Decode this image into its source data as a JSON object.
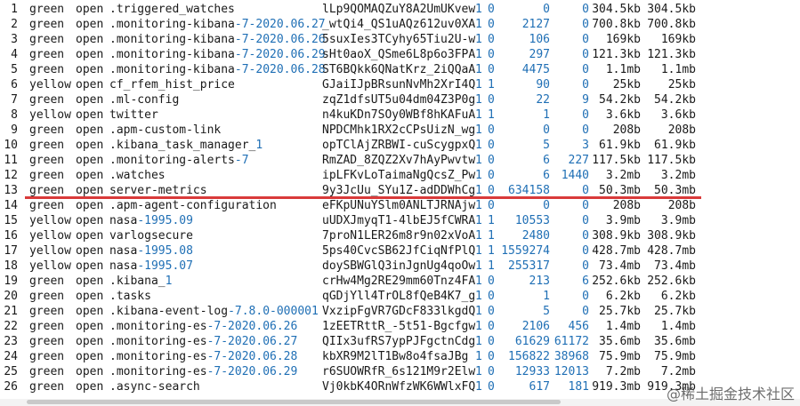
{
  "rows": [
    {
      "n": "1",
      "health": "green",
      "status": "open",
      "index": [
        ".triggered_watches"
      ],
      "uuid": "lLp9QOMAQZuY8A2UmUKvew",
      "pri": "1",
      "rep": "0",
      "docs": "0",
      "del": "0",
      "size": "304.5kb",
      "psize": "304.5kb"
    },
    {
      "n": "2",
      "health": "green",
      "status": "open",
      "index": [
        ".monitoring-kibana",
        "-7-2020.06.27"
      ],
      "uuid": "_wtQi4_QS1uAQz612uv0XA",
      "pri": "1",
      "rep": "0",
      "docs": "2127",
      "del": "0",
      "size": "700.8kb",
      "psize": "700.8kb"
    },
    {
      "n": "3",
      "health": "green",
      "status": "open",
      "index": [
        ".monitoring-kibana",
        "-7-2020.06.26"
      ],
      "uuid": "5suxIes3TCyhy65Tiu2U-w",
      "pri": "1",
      "rep": "0",
      "docs": "106",
      "del": "0",
      "size": "169kb",
      "psize": "169kb"
    },
    {
      "n": "4",
      "health": "green",
      "status": "open",
      "index": [
        ".monitoring-kibana",
        "-7-2020.06.29"
      ],
      "uuid": "sHt0aoX_QSme6L8p6o3FPA",
      "pri": "1",
      "rep": "0",
      "docs": "297",
      "del": "0",
      "size": "121.3kb",
      "psize": "121.3kb"
    },
    {
      "n": "5",
      "health": "green",
      "status": "open",
      "index": [
        ".monitoring-kibana",
        "-7-2020.06.28"
      ],
      "uuid": "ST6BQkk6QNatKrz_2iQQaA",
      "pri": "1",
      "rep": "0",
      "docs": "4475",
      "del": "0",
      "size": "1.1mb",
      "psize": "1.1mb"
    },
    {
      "n": "6",
      "health": "yellow",
      "status": "open",
      "index": [
        "cf_rfem_hist_price"
      ],
      "uuid": "GJaiIJpBRsunNvMh2XrI4Q",
      "pri": "1",
      "rep": "1",
      "docs": "90",
      "del": "0",
      "size": "25kb",
      "psize": "25kb"
    },
    {
      "n": "7",
      "health": "green",
      "status": "open",
      "index": [
        ".ml-config"
      ],
      "uuid": "zqZ1dfsUT5u04dm04Z3P0g",
      "pri": "1",
      "rep": "0",
      "docs": "22",
      "del": "9",
      "size": "54.2kb",
      "psize": "54.2kb"
    },
    {
      "n": "8",
      "health": "yellow",
      "status": "open",
      "index": [
        "twitter"
      ],
      "uuid": "n4kuKDn7SOy0WBf8hKAFuA",
      "pri": "1",
      "rep": "1",
      "docs": "1",
      "del": "0",
      "size": "3.6kb",
      "psize": "3.6kb"
    },
    {
      "n": "9",
      "health": "green",
      "status": "open",
      "index": [
        ".apm-custom-link"
      ],
      "uuid": "NPDCMhk1RX2cCPsUizN_wg",
      "pri": "1",
      "rep": "0",
      "docs": "0",
      "del": "0",
      "size": "208b",
      "psize": "208b"
    },
    {
      "n": "10",
      "health": "green",
      "status": "open",
      "index": [
        ".kibana_task_manager_",
        "1"
      ],
      "uuid": "opTClAjZRBWI-cuScygpxQ",
      "pri": "1",
      "rep": "0",
      "docs": "5",
      "del": "3",
      "size": "61.9kb",
      "psize": "61.9kb"
    },
    {
      "n": "11",
      "health": "green",
      "status": "open",
      "index": [
        ".monitoring-alerts",
        "-7"
      ],
      "uuid": "RmZAD_8ZQZ2Xv7hAyPwvtw",
      "pri": "1",
      "rep": "0",
      "docs": "6",
      "del": "227",
      "size": "117.5kb",
      "psize": "117.5kb"
    },
    {
      "n": "12",
      "health": "green",
      "status": "open",
      "index": [
        ".watches"
      ],
      "uuid": "ipLFKvLoTaimaNgQcsZ_Pw",
      "pri": "1",
      "rep": "0",
      "docs": "6",
      "del": "1440",
      "size": "3.2mb",
      "psize": "3.2mb"
    },
    {
      "n": "13",
      "health": "green",
      "status": "open",
      "index": [
        "server-metrics"
      ],
      "uuid": "9y3JcUu_SYu1Z-adDDWhCg",
      "pri": "1",
      "rep": "0",
      "docs": "634158",
      "del": "0",
      "size": "50.3mb",
      "psize": "50.3mb"
    },
    {
      "n": "14",
      "health": "green",
      "status": "open",
      "index": [
        ".apm-agent-configuration"
      ],
      "uuid": "eFKpUNuYSlm0ANLTJRNAjw",
      "pri": "1",
      "rep": "0",
      "docs": "0",
      "del": "0",
      "size": "208b",
      "psize": "208b"
    },
    {
      "n": "15",
      "health": "yellow",
      "status": "open",
      "index": [
        "nasa",
        "-1995.09"
      ],
      "uuid": "uUDXJmyqT1-4lbEJ5fCWRA",
      "pri": "1",
      "rep": "1",
      "docs": "10553",
      "del": "0",
      "size": "3.9mb",
      "psize": "3.9mb"
    },
    {
      "n": "16",
      "health": "yellow",
      "status": "open",
      "index": [
        "varlogsecure"
      ],
      "uuid": "7proN1LER26m8r9n02xVoA",
      "pri": "1",
      "rep": "1",
      "docs": "2480",
      "del": "0",
      "size": "308.9kb",
      "psize": "308.9kb"
    },
    {
      "n": "17",
      "health": "yellow",
      "status": "open",
      "index": [
        "nasa",
        "-1995.08"
      ],
      "uuid": "5ps40CvcSB62JfCiqNfPlQ",
      "pri": "1",
      "rep": "1",
      "docs": "1559274",
      "del": "0",
      "size": "428.7mb",
      "psize": "428.7mb"
    },
    {
      "n": "18",
      "health": "yellow",
      "status": "open",
      "index": [
        "nasa",
        "-1995.07"
      ],
      "uuid": "doySBWGlQ3inJgnUg4qoOw",
      "pri": "1",
      "rep": "1",
      "docs": "255317",
      "del": "0",
      "size": "73.4mb",
      "psize": "73.4mb"
    },
    {
      "n": "19",
      "health": "green",
      "status": "open",
      "index": [
        ".kibana_",
        "1"
      ],
      "uuid": "crHw4Mg2RE29mm60Tnz4FA",
      "pri": "1",
      "rep": "0",
      "docs": "213",
      "del": "6",
      "size": "252.6kb",
      "psize": "252.6kb"
    },
    {
      "n": "20",
      "health": "green",
      "status": "open",
      "index": [
        ".tasks"
      ],
      "uuid": "qGDjYll4TrOL8fQeB4K7_g",
      "pri": "1",
      "rep": "0",
      "docs": "1",
      "del": "0",
      "size": "6.2kb",
      "psize": "6.2kb"
    },
    {
      "n": "21",
      "health": "green",
      "status": "open",
      "index": [
        ".kibana-event-log",
        "-7.8.0-000001"
      ],
      "uuid": "VxzipFgVR7GDcF833lkgdQ",
      "pri": "1",
      "rep": "0",
      "docs": "5",
      "del": "0",
      "size": "25.7kb",
      "psize": "25.7kb"
    },
    {
      "n": "22",
      "health": "green",
      "status": "open",
      "index": [
        ".monitoring-es",
        "-7-2020.06.26"
      ],
      "uuid": "1zEETRttR_-5t51-Bgcfgw",
      "pri": "1",
      "rep": "0",
      "docs": "2106",
      "del": "456",
      "size": "1.4mb",
      "psize": "1.4mb"
    },
    {
      "n": "23",
      "health": "green",
      "status": "open",
      "index": [
        ".monitoring-es",
        "-7-2020.06.27"
      ],
      "uuid": "QIIx3ufRS7ypPJFgctnCdg",
      "pri": "1",
      "rep": "0",
      "docs": "61629",
      "del": "61172",
      "size": "35.6mb",
      "psize": "35.6mb"
    },
    {
      "n": "24",
      "health": "green",
      "status": "open",
      "index": [
        ".monitoring-es",
        "-7-2020.06.28"
      ],
      "uuid": "kbXR9M2lT1Bw8o4fsaJBg",
      "pri": "1",
      "rep": "0",
      "docs": "156822",
      "del": "38968",
      "size": "75.9mb",
      "psize": "75.9mb"
    },
    {
      "n": "25",
      "health": "green",
      "status": "open",
      "index": [
        ".monitoring-es",
        "-7-2020.06.29"
      ],
      "uuid": "r6SUOWRfR_6s121M9r2Elw",
      "pri": "1",
      "rep": "0",
      "docs": "12933",
      "del": "12013",
      "size": "7.2mb",
      "psize": "7.2mb"
    },
    {
      "n": "26",
      "health": "green",
      "status": "open",
      "index": [
        ".async-search"
      ],
      "uuid": "Vj0kbK4ORnWfzWK6WWlxFQ",
      "pri": "1",
      "rep": "0",
      "docs": "617",
      "del": "181",
      "size": "919.3mb",
      "psize": "919.3mb"
    }
  ],
  "watermark": "@稀土掘金技术社区",
  "colors": {
    "text": "#1a1a1a",
    "number": "#1f6fb5",
    "highlight_line": "#d93a3a"
  }
}
